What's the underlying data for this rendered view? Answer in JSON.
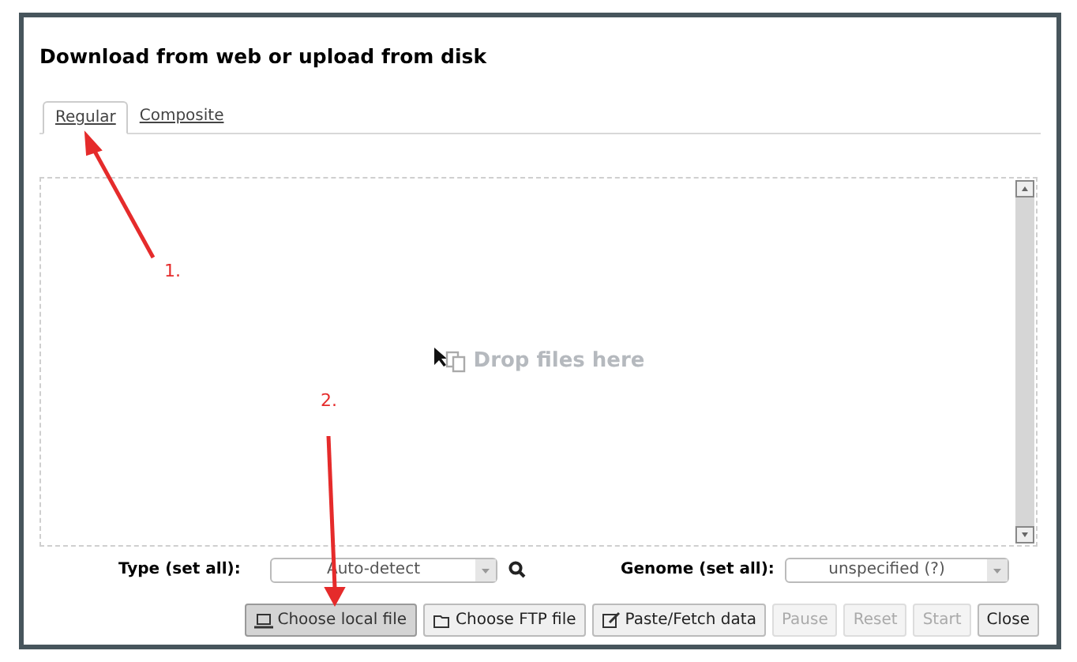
{
  "dialog": {
    "title": "Download from web or upload from disk"
  },
  "tabs": [
    {
      "label": "Regular",
      "selected": true
    },
    {
      "label": "Composite",
      "selected": false
    }
  ],
  "drop_zone": {
    "text": "Drop files here"
  },
  "type_select": {
    "label": "Type (set all):",
    "value": "Auto-detect"
  },
  "genome_select": {
    "label": "Genome (set all):",
    "value": "unspecified (?)"
  },
  "buttons": [
    {
      "label": "Choose local file",
      "kind": "laptop",
      "selected": true,
      "disabled": false
    },
    {
      "label": "Choose FTP file",
      "kind": "folder",
      "selected": false,
      "disabled": false
    },
    {
      "label": "Paste/Fetch data",
      "kind": "edit",
      "selected": false,
      "disabled": false
    },
    {
      "label": "Pause",
      "selected": false,
      "disabled": true
    },
    {
      "label": "Reset",
      "selected": false,
      "disabled": true
    },
    {
      "label": "Start",
      "selected": false,
      "disabled": true
    },
    {
      "label": "Close",
      "selected": false,
      "disabled": false
    }
  ],
  "annotations": [
    {
      "label": "1."
    },
    {
      "label": "2."
    }
  ]
}
